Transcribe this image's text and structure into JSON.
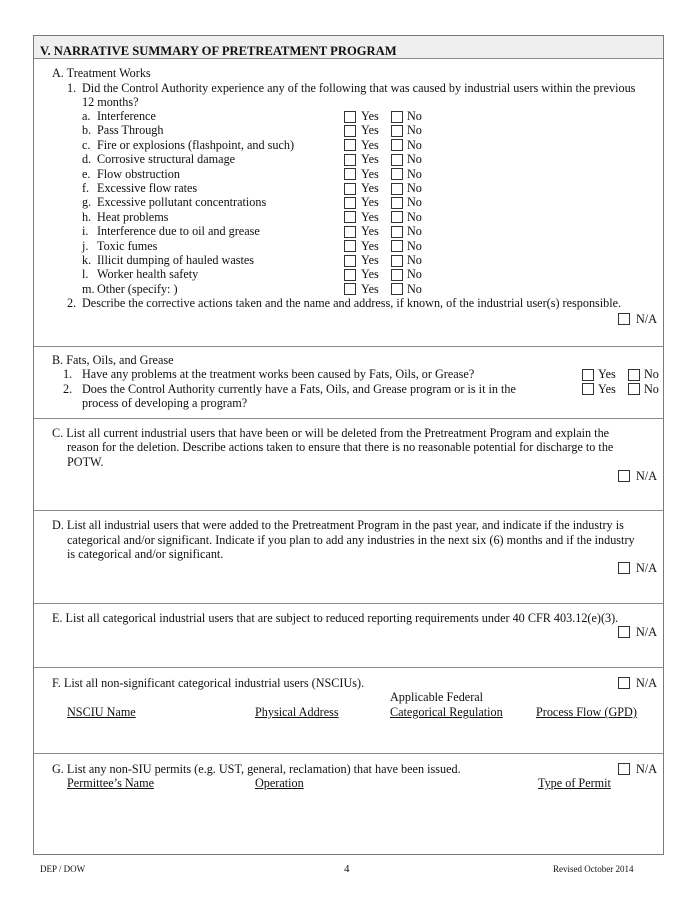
{
  "section": {
    "title": "V.  NARRATIVE SUMMARY OF PRETREATMENT PROGRAM"
  },
  "a": {
    "heading": "A. Treatment Works",
    "q1_num": "1.",
    "q1_text_line1": "Did the Control Authority experience any of the following that was caused by industrial users within the previous",
    "q1_text_line2": "12 months?",
    "yes_label": "Yes",
    "no_label": "No",
    "items": [
      {
        "letter": "a.",
        "label": "Interference"
      },
      {
        "letter": "b.",
        "label": "Pass Through"
      },
      {
        "letter": "c.",
        "label": "Fire or explosions (flashpoint, and such)"
      },
      {
        "letter": "d.",
        "label": "Corrosive structural damage"
      },
      {
        "letter": "e.",
        "label": "Flow obstruction"
      },
      {
        "letter": "f.",
        "label": "Excessive flow rates"
      },
      {
        "letter": "g.",
        "label": "Excessive pollutant concentrations"
      },
      {
        "letter": "h.",
        "label": "Heat problems"
      },
      {
        "letter": "i.",
        "label": "Interference due to oil and grease"
      },
      {
        "letter": "j.",
        "label": "Toxic fumes"
      },
      {
        "letter": "k.",
        "label": "Illicit dumping of hauled wastes"
      },
      {
        "letter": "l.",
        "label": "Worker health safety"
      },
      {
        "letter": "m.",
        "label": "Other (specify:            )"
      }
    ],
    "q2_num": "2.",
    "q2_text": "Describe the corrective actions taken and the name and address, if known, of the industrial user(s) responsible.",
    "na_label": "N/A"
  },
  "b": {
    "heading": "B. Fats, Oils, and Grease",
    "q1_num": "1.",
    "q1_text": "Have any problems at the treatment works been caused by Fats, Oils, or Grease?",
    "q2_num": "2.",
    "q2_text_line1": "Does the Control Authority currently have a Fats, Oils, and Grease program or is it in the",
    "q2_text_line2": "process of developing a program?",
    "yes_label": "Yes",
    "no_label": "No"
  },
  "c": {
    "line1": "C. List all current industrial users that have been or will be deleted from the Pretreatment Program and explain the",
    "line2": "reason for the deletion.  Describe actions taken to ensure that there is no reasonable potential for discharge to the",
    "line3": "POTW.",
    "na_label": "N/A"
  },
  "d": {
    "line1": "D. List all industrial users that were added to the Pretreatment Program in the past year, and indicate if the industry is",
    "line2": "categorical and/or significant.  Indicate if you plan to add any industries in the next six (6) months and if the industry",
    "line3": "is categorical and/or significant.",
    "na_label": "N/A"
  },
  "e": {
    "line1": "E. List all categorical industrial users that are subject to reduced reporting requirements under 40 CFR 403.12(e)(3).",
    "na_label": "N/A"
  },
  "f": {
    "line1": "F. List all non-significant categorical industrial users (NSCIUs).",
    "na_label": "N/A",
    "columns": [
      "NSCIU Name",
      "Physical Address",
      "Applicable Federal",
      "Categorical Regulation",
      "Process Flow (GPD)"
    ]
  },
  "g": {
    "line1": "G. List any non-SIU permits (e.g. UST, general, reclamation) that have been issued.",
    "na_label": "N/A",
    "columns": [
      "Permittee’s Name",
      "Operation",
      "Type of Permit"
    ]
  },
  "footer": {
    "left": "DEP / DOW",
    "page": "4",
    "right": "Revised October 2014"
  }
}
